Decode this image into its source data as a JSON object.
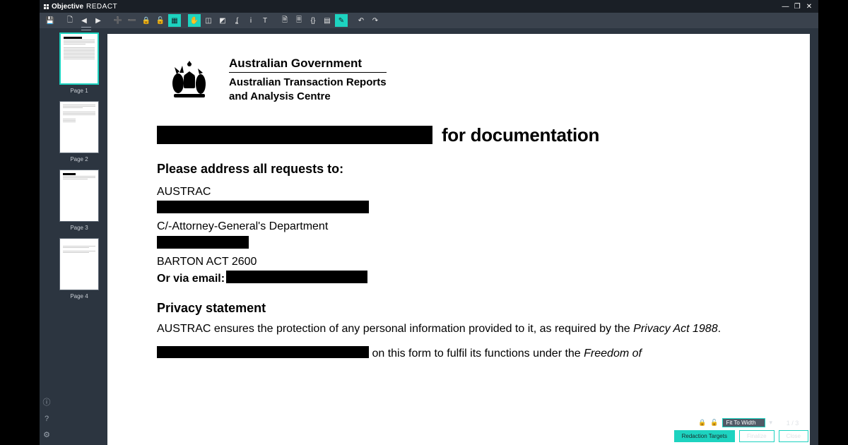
{
  "app": {
    "brand1": "Objective",
    "brand2": "REDACT"
  },
  "window": {
    "min": "—",
    "restore": "❐",
    "close": "✕"
  },
  "thumbs": [
    {
      "label": "Page 1",
      "active": true
    },
    {
      "label": "Page 2",
      "active": false
    },
    {
      "label": "Page 3",
      "active": false
    },
    {
      "label": "Page 4",
      "active": false
    }
  ],
  "document": {
    "letterhead": {
      "gov": "Australian Government",
      "dept1": "Australian Transaction Reports",
      "dept2": "and Analysis Centre"
    },
    "title_suffix": "for documentation",
    "address_heading": "Please address all requests to:",
    "addr_line1": "AUSTRAC",
    "addr_line3": "C/-Attorney-General's Department",
    "addr_line5": "BARTON  ACT  2600",
    "email_label": "Or via email:",
    "privacy_heading": "Privacy statement",
    "privacy_p1a": "AUSTRAC ensures the protection of any personal information provided to it, as required by the ",
    "privacy_p1b": "Privacy Act 1988",
    "privacy_p1c": ".",
    "privacy_p2b": " on this form to fulfil its functions under the ",
    "privacy_p2c": "Freedom of"
  },
  "statusbar": {
    "zoom_label": "Fit To Width",
    "page_indicator": "1 / 3",
    "btn_targets": "Redaction Targets",
    "btn_finalize": "Finalize",
    "btn_close": "Close"
  }
}
